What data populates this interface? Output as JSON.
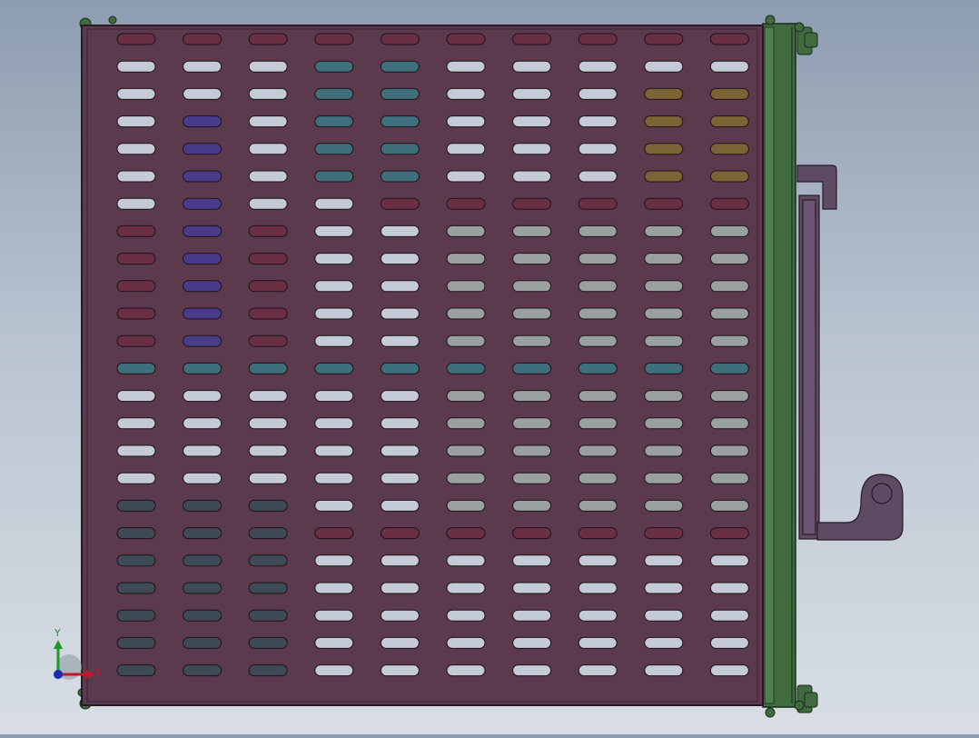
{
  "viewport": {
    "background_top": "#8e9cb0",
    "background_bottom": "#d9dee5"
  },
  "model": {
    "plate_color": "#5a3a4c",
    "plate_edge_color": "#2a1a24",
    "side_bar_color": "#3f6b3f",
    "bracket_color": "#5e4a62",
    "slot_rows": 24,
    "slot_cols": 10,
    "slot_colors": {
      "light": "#c4cad6",
      "dark": "#3e4a56",
      "maroon": "#6a2f43",
      "purple": "#4a3a8a",
      "teal": "#3f6f7a",
      "olive": "#7a6433",
      "gray": "#9aa0a0"
    }
  },
  "triad": {
    "x_label": "X",
    "y_label": "Y",
    "x_color": "#c0182a",
    "y_color": "#1a9a2a",
    "z_color": "#1a2ab0"
  }
}
